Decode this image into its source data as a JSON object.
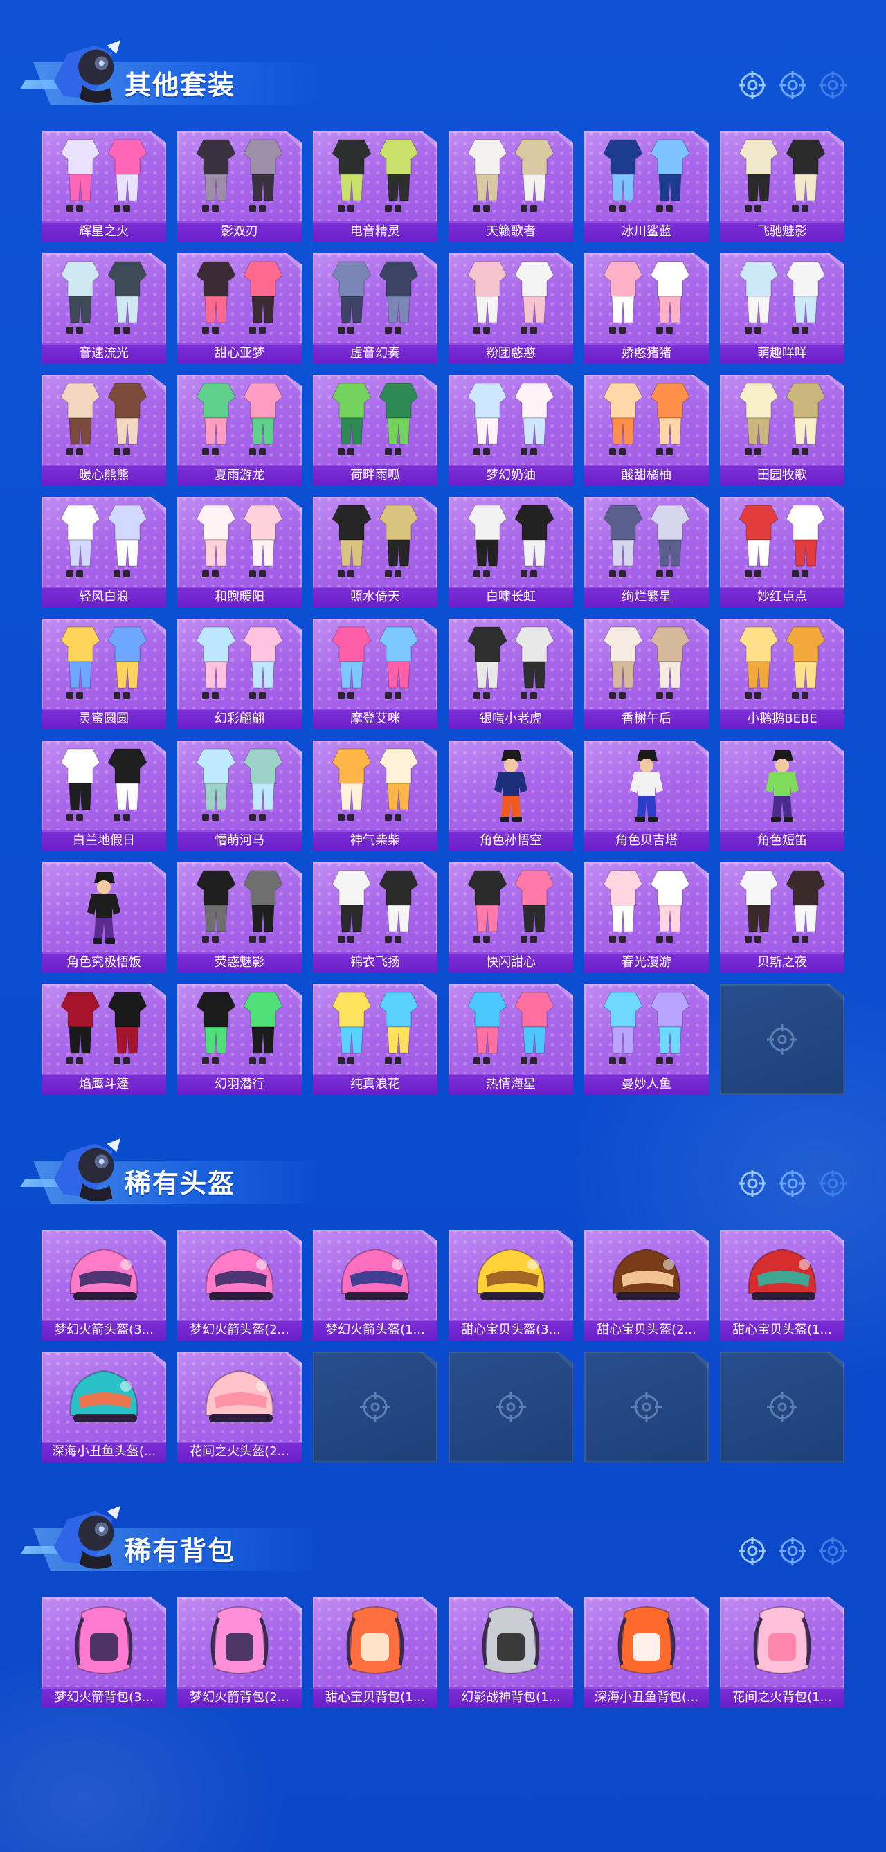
{
  "sections": [
    {
      "title": "其他套装",
      "items": [
        {
          "label": "辉星之火",
          "type": "outfit",
          "palette": [
            "#e9e2ff",
            "#ff66b5"
          ]
        },
        {
          "label": "影双刃",
          "type": "outfit",
          "palette": [
            "#3a3140",
            "#9e8fa8"
          ]
        },
        {
          "label": "电音精灵",
          "type": "outfit",
          "palette": [
            "#2d2f2e",
            "#c9e06a"
          ]
        },
        {
          "label": "天籁歌者",
          "type": "outfit",
          "palette": [
            "#f4f2ee",
            "#d9c9a3"
          ]
        },
        {
          "label": "冰川鲨蓝",
          "type": "outfit",
          "palette": [
            "#1e3c8f",
            "#7ec3ff"
          ]
        },
        {
          "label": "飞驰魅影",
          "type": "outfit",
          "palette": [
            "#f0e8c8",
            "#2a2a2a"
          ]
        },
        {
          "label": "音速流光",
          "type": "outfit",
          "palette": [
            "#cfe8f2",
            "#3d4b57"
          ]
        },
        {
          "label": "甜心亚梦",
          "type": "outfit",
          "palette": [
            "#3b2a33",
            "#ff6a8e"
          ]
        },
        {
          "label": "虚音幻奏",
          "type": "outfit",
          "palette": [
            "#7a86b5",
            "#3c4364"
          ]
        },
        {
          "label": "粉团憨憨",
          "type": "outfit",
          "palette": [
            "#f7c3cf",
            "#f4f4f4"
          ]
        },
        {
          "label": "娇憨猪猪",
          "type": "outfit",
          "palette": [
            "#ffb1c8",
            "#ffffff"
          ]
        },
        {
          "label": "萌趣咩咩",
          "type": "outfit",
          "palette": [
            "#cde9f7",
            "#f5f5f5"
          ]
        },
        {
          "label": "暖心熊熊",
          "type": "outfit",
          "palette": [
            "#f4d7c1",
            "#7b4a3a"
          ]
        },
        {
          "label": "夏雨游龙",
          "type": "outfit",
          "palette": [
            "#5fd18c",
            "#ff9ec1"
          ]
        },
        {
          "label": "荷畔雨呱",
          "type": "outfit",
          "palette": [
            "#73d35c",
            "#2e8a54"
          ]
        },
        {
          "label": "梦幻奶油",
          "type": "outfit",
          "palette": [
            "#cfe6ff",
            "#fff3f7"
          ]
        },
        {
          "label": "酸甜橘柚",
          "type": "outfit",
          "palette": [
            "#ffd7a8",
            "#ff8f4a"
          ]
        },
        {
          "label": "田园牧歌",
          "type": "outfit",
          "palette": [
            "#f6efc7",
            "#c9b77c"
          ]
        },
        {
          "label": "轻风白浪",
          "type": "outfit",
          "palette": [
            "#ffffff",
            "#d2d8ff"
          ]
        },
        {
          "label": "和煦暖阳",
          "type": "outfit",
          "palette": [
            "#fff2f4",
            "#ffd1da"
          ]
        },
        {
          "label": "照水倚天",
          "type": "outfit",
          "palette": [
            "#262626",
            "#d9c37e"
          ]
        },
        {
          "label": "白啸长虹",
          "type": "outfit",
          "palette": [
            "#f2f2f2",
            "#222222"
          ]
        },
        {
          "label": "绚烂繁星",
          "type": "outfit",
          "palette": [
            "#5b5f8e",
            "#d6d7ef"
          ]
        },
        {
          "label": "妙红点点",
          "type": "outfit",
          "palette": [
            "#e23c3c",
            "#ffffff"
          ]
        },
        {
          "label": "灵蜜圆圆",
          "type": "outfit",
          "palette": [
            "#ffd45a",
            "#6fa7ff"
          ]
        },
        {
          "label": "幻彩翩翩",
          "type": "outfit",
          "palette": [
            "#bfe6ff",
            "#ffc2e1"
          ]
        },
        {
          "label": "摩登艾咪",
          "type": "outfit",
          "palette": [
            "#ff5fa9",
            "#7cc7ff"
          ]
        },
        {
          "label": "银嗤小老虎",
          "type": "outfit",
          "palette": [
            "#2f2f2f",
            "#e8e8e8"
          ]
        },
        {
          "label": "香榭午后",
          "type": "outfit",
          "palette": [
            "#f5ebe1",
            "#d6b89a"
          ]
        },
        {
          "label": "小鹅鹅BEBE",
          "type": "outfit",
          "palette": [
            "#ffe08a",
            "#f2a93b"
          ]
        },
        {
          "label": "白兰地假日",
          "type": "outfit",
          "palette": [
            "#ffffff",
            "#1f1f1f"
          ]
        },
        {
          "label": "懵萌河马",
          "type": "outfit",
          "palette": [
            "#bfe9ff",
            "#9dd2c8"
          ]
        },
        {
          "label": "神气柴柴",
          "type": "outfit",
          "palette": [
            "#ffb648",
            "#fff2d8"
          ]
        },
        {
          "label": "角色孙悟空",
          "type": "character",
          "palette": [
            "#f25a1d",
            "#1d2e7a"
          ]
        },
        {
          "label": "角色贝吉塔",
          "type": "character",
          "palette": [
            "#2a3ec7",
            "#f2f2f2"
          ]
        },
        {
          "label": "角色短笛",
          "type": "character",
          "palette": [
            "#4b2c8c",
            "#7fdc5a"
          ]
        },
        {
          "label": "角色究极悟饭",
          "type": "character",
          "palette": [
            "#5b2d8f",
            "#1d1d1d"
          ]
        },
        {
          "label": "荧惑魅影",
          "type": "outfit",
          "palette": [
            "#1e1e1e",
            "#6f6f6f"
          ]
        },
        {
          "label": "锦衣飞扬",
          "type": "outfit",
          "palette": [
            "#f5f5f5",
            "#2a2a2a"
          ]
        },
        {
          "label": "快闪甜心",
          "type": "outfit",
          "palette": [
            "#2b2b2b",
            "#ff7aa8"
          ]
        },
        {
          "label": "春光漫游",
          "type": "outfit",
          "palette": [
            "#ffd6e2",
            "#ffffff"
          ]
        },
        {
          "label": "贝斯之夜",
          "type": "outfit",
          "palette": [
            "#f6f6f6",
            "#3a2a2a"
          ]
        },
        {
          "label": "焰鹰斗篷",
          "type": "outfit",
          "palette": [
            "#a5142a",
            "#1a1a1a"
          ]
        },
        {
          "label": "幻羽潜行",
          "type": "outfit",
          "palette": [
            "#1b1b1b",
            "#4fe07a"
          ]
        },
        {
          "label": "纯真浪花",
          "type": "outfit",
          "palette": [
            "#ffe25c",
            "#5bd1ff"
          ]
        },
        {
          "label": "热情海星",
          "type": "outfit",
          "palette": [
            "#4cc8ff",
            "#ff6fa0"
          ]
        },
        {
          "label": "曼妙人鱼",
          "type": "outfit",
          "palette": [
            "#6fd8ff",
            "#b9a5ff"
          ]
        },
        {
          "label": "",
          "type": "empty",
          "palette": []
        }
      ]
    },
    {
      "title": "稀有头盔",
      "items": [
        {
          "label": "梦幻火箭头盔(3...",
          "type": "helmet",
          "palette": [
            "#ff7bc8",
            "#3b2f6a"
          ]
        },
        {
          "label": "梦幻火箭头盔(2...",
          "type": "helmet",
          "palette": [
            "#ff7bc8",
            "#3b2f6a"
          ]
        },
        {
          "label": "梦幻火箭头盔(1...",
          "type": "helmet",
          "palette": [
            "#ff6fbf",
            "#2c3a8f"
          ]
        },
        {
          "label": "甜心宝贝头盔(3...",
          "type": "helmet",
          "palette": [
            "#ffd23a",
            "#9a5a22"
          ]
        },
        {
          "label": "甜心宝贝头盔(2...",
          "type": "helmet",
          "palette": [
            "#7a3b18",
            "#ffd1a0"
          ]
        },
        {
          "label": "甜心宝贝头盔(1...",
          "type": "helmet",
          "palette": [
            "#d62e2e",
            "#2fb4a0"
          ]
        },
        {
          "label": "深海小丑鱼头盔(...",
          "type": "helmet",
          "palette": [
            "#29c0c7",
            "#ff6b3d"
          ]
        },
        {
          "label": "花间之火头盔(2...",
          "type": "helmet",
          "palette": [
            "#ffc3c9",
            "#ff8fa5"
          ]
        },
        {
          "label": "",
          "type": "empty",
          "palette": []
        },
        {
          "label": "",
          "type": "empty",
          "palette": []
        },
        {
          "label": "",
          "type": "empty",
          "palette": []
        },
        {
          "label": "",
          "type": "empty",
          "palette": []
        }
      ]
    },
    {
      "title": "稀有背包",
      "items": [
        {
          "label": "梦幻火箭背包(3...",
          "type": "backpack",
          "palette": [
            "#ff7bd1",
            "#3a2b5a"
          ]
        },
        {
          "label": "梦幻火箭背包(2...",
          "type": "backpack",
          "palette": [
            "#ff8fd8",
            "#3a2b5a"
          ]
        },
        {
          "label": "甜心宝贝背包(1...",
          "type": "backpack",
          "palette": [
            "#ff6f3f",
            "#fff1d8"
          ]
        },
        {
          "label": "幻影战神背包(1...",
          "type": "backpack",
          "palette": [
            "#c9ccd2",
            "#2a2a2a"
          ]
        },
        {
          "label": "深海小丑鱼背包(...",
          "type": "backpack",
          "palette": [
            "#ff6a2c",
            "#ffffff"
          ]
        },
        {
          "label": "花间之火背包(1...",
          "type": "backpack",
          "palette": [
            "#ffc1da",
            "#ff7fa7"
          ]
        }
      ]
    }
  ]
}
